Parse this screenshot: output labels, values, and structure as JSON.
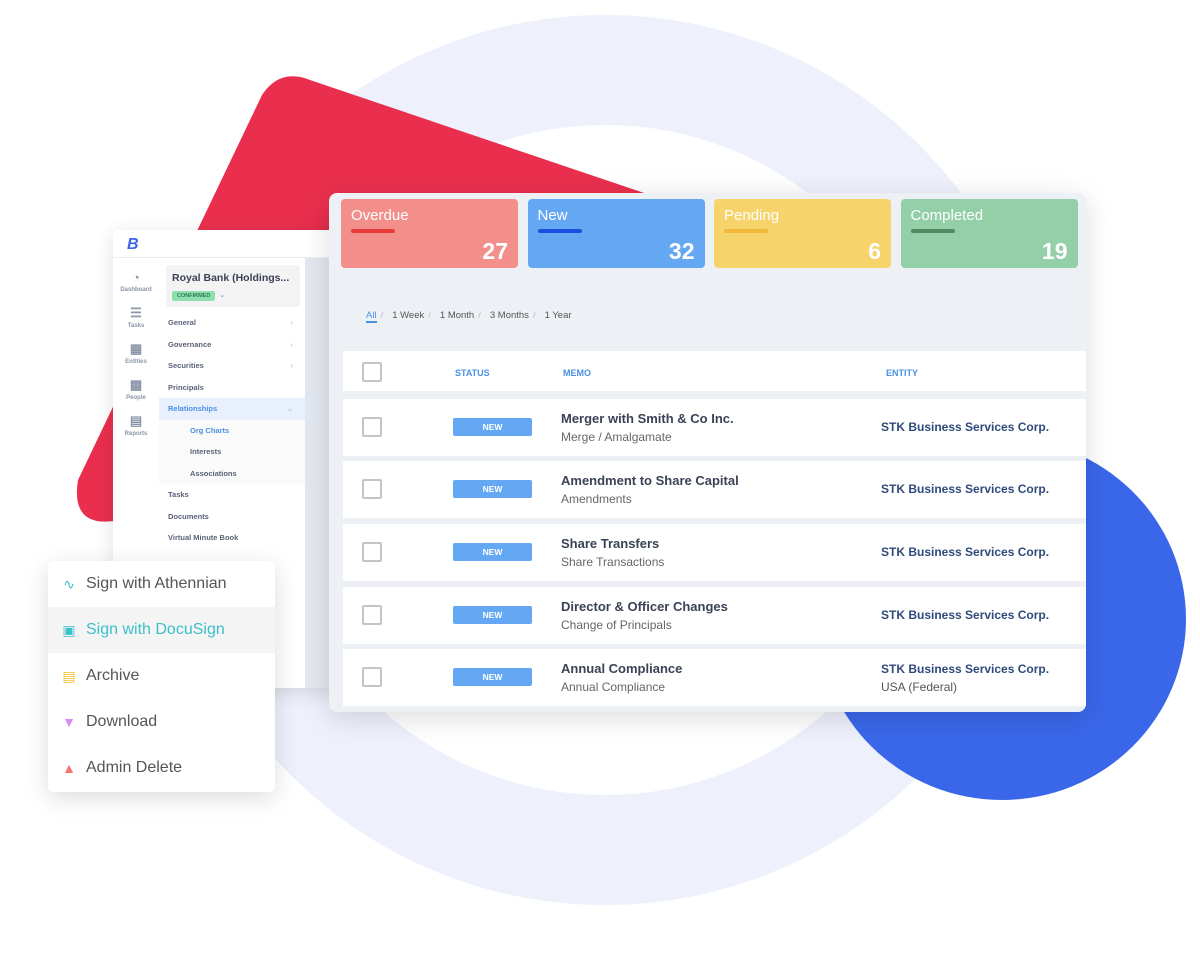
{
  "colors": {
    "ring": "#eef1fc",
    "red_shape": "#ea2f4e",
    "blue_circle": "#3a67ea",
    "accent": "#4a90e2"
  },
  "sidebar": {
    "logo": "B",
    "rail": [
      {
        "icon": "dashboard-icon",
        "label": "Dashboard"
      },
      {
        "icon": "tasks-icon",
        "label": "Tasks"
      },
      {
        "icon": "building-icon",
        "label": "Entities"
      },
      {
        "icon": "id-card-icon",
        "label": "People"
      },
      {
        "icon": "report-icon",
        "label": "Reports"
      }
    ],
    "entity": {
      "name": "Royal Bank (Holdings...",
      "status": "CONFIRMED"
    },
    "nav": [
      {
        "label": "General"
      },
      {
        "label": "Governance"
      },
      {
        "label": "Securities"
      },
      {
        "label": "Principals"
      },
      {
        "label": "Relationships"
      },
      {
        "label": "Org Charts"
      },
      {
        "label": "Interests"
      },
      {
        "label": "Associations"
      },
      {
        "label": "Tasks"
      },
      {
        "label": "Documents"
      },
      {
        "label": "Virtual Minute Book"
      }
    ]
  },
  "cards": [
    {
      "label": "Overdue",
      "count": "27",
      "bg": "#f28f8b",
      "line": "#ea3b3b"
    },
    {
      "label": "New",
      "count": "32",
      "bg": "#64a8f4",
      "line": "#1d4fe0"
    },
    {
      "label": "Pending",
      "count": "6",
      "bg": "#f7d36b",
      "line": "#f0b83a"
    },
    {
      "label": "Completed",
      "count": "19",
      "bg": "#93cfa7",
      "line": "#4e8a60"
    }
  ],
  "filters": [
    "All",
    "1 Week",
    "1 Month",
    "3 Months",
    "1 Year"
  ],
  "table": {
    "headers": {
      "status": "STATUS",
      "memo": "MEMO",
      "entity": "ENTITY"
    },
    "rows": [
      {
        "status": "NEW",
        "title": "Merger with Smith & Co Inc.",
        "type": "Merge / Amalgamate",
        "entity": "STK Business Services Corp.",
        "entity2": ""
      },
      {
        "status": "NEW",
        "title": "Amendment to Share Capital",
        "type": "Amendments",
        "entity": "STK Business Services Corp.",
        "entity2": ""
      },
      {
        "status": "NEW",
        "title": "Share Transfers",
        "type": "Share Transactions",
        "entity": "STK Business Services Corp.",
        "entity2": ""
      },
      {
        "status": "NEW",
        "title": "Director & Officer Changes",
        "type": "Change of Principals",
        "entity": "STK Business Services Corp.",
        "entity2": ""
      },
      {
        "status": "NEW",
        "title": "Annual Compliance",
        "type": "Annual Compliance",
        "entity": "STK Business Services Corp.",
        "entity2": "USA (Federal)"
      }
    ]
  },
  "menu": [
    {
      "label": "Sign with Athennian",
      "icon": "signature-icon",
      "color": "#3cc0c8"
    },
    {
      "label": "Sign with DocuSign",
      "icon": "document-icon",
      "color": "#3cc0c8"
    },
    {
      "label": "Archive",
      "icon": "archive-icon",
      "color": "#f5c02a"
    },
    {
      "label": "Download",
      "icon": "download-file-icon",
      "color": "#d98af0"
    },
    {
      "label": "Admin Delete",
      "icon": "trash-icon",
      "color": "#f47474"
    }
  ]
}
